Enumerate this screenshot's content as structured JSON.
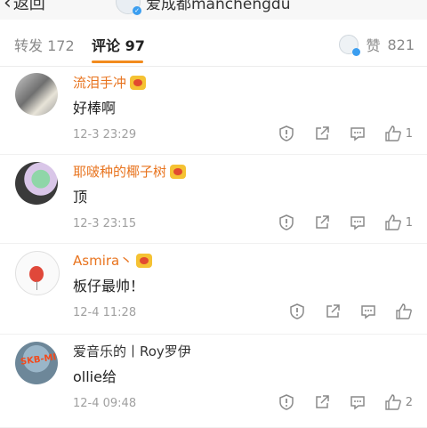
{
  "header": {
    "back_label": "返回",
    "owner_name": "爱成都manchengdu"
  },
  "tabs": {
    "repost_label": "转发",
    "repost_count": "172",
    "comments_label": "评论",
    "comments_count": "97",
    "likes_label": "赞",
    "likes_count": "821"
  },
  "comments": [
    {
      "user": "流泪手冲",
      "text": "好棒啊",
      "time": "12-3 23:29",
      "likes": "1"
    },
    {
      "user": "耶啵种的椰子树",
      "text": "顶",
      "time": "12-3 23:15",
      "likes": "1"
    },
    {
      "user": "Asmira丶",
      "text": "板仔最帅！",
      "time": "12-4 11:28",
      "likes": ""
    },
    {
      "user": "爱音乐的丨Roy罗伊",
      "text": "ollie给",
      "time": "12-4 09:48",
      "likes": "2"
    }
  ],
  "avatar_texts": {
    "c4": "SKB-MI"
  },
  "colors": {
    "accent": "#f28b1e",
    "username": "#e8741f",
    "meta": "#a0a0a0"
  },
  "icons": [
    "report-icon",
    "share-icon",
    "reply-icon",
    "thumbs-up-icon",
    "chevron-left-icon",
    "verified-icon",
    "vip-badge-icon"
  ]
}
